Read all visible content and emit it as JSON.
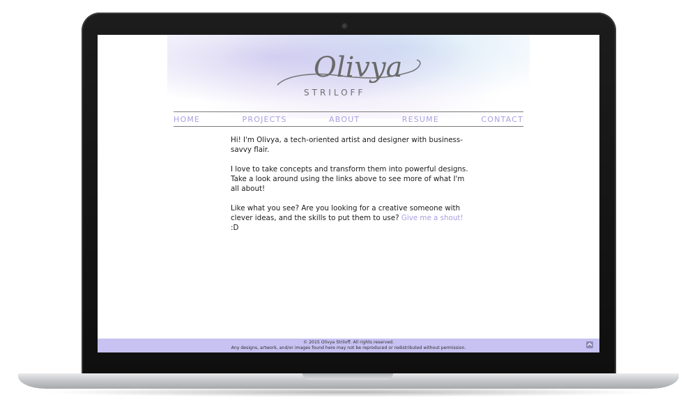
{
  "logo": {
    "script": "Olivya",
    "sub": "STRILOFF"
  },
  "nav": {
    "items": [
      {
        "label": "HOME"
      },
      {
        "label": "PROJECTS"
      },
      {
        "label": "ABOUT"
      },
      {
        "label": "RESUME"
      },
      {
        "label": "CONTACT"
      }
    ]
  },
  "content": {
    "paragraph1": "Hi! I'm Olivya, a tech-oriented artist and designer with business-savvy flair.",
    "paragraph2": "I love to take concepts and transform them into powerful designs. Take a look around using the links above to see more of what I'm all about!",
    "paragraph3_text": "Like what you see? Are you looking for a creative someone with clever ideas, and the skills to put them to use? ",
    "paragraph3_link": "Give me a shout!",
    "paragraph3_suffix": " :D"
  },
  "footer": {
    "copyright": "© 2015 Olivya Striloff. All rights reserved.",
    "notice": "Any designs, artwork, and/or images found here may not be reproduced or redistributed without permission."
  },
  "colors": {
    "accent": "#a89fe0",
    "footer_bg": "#c7c2f2",
    "bezel": "#111111",
    "text": "#1b1b1b"
  },
  "icons": {
    "footer": "back-to-top-icon",
    "camera": "camera-icon"
  }
}
